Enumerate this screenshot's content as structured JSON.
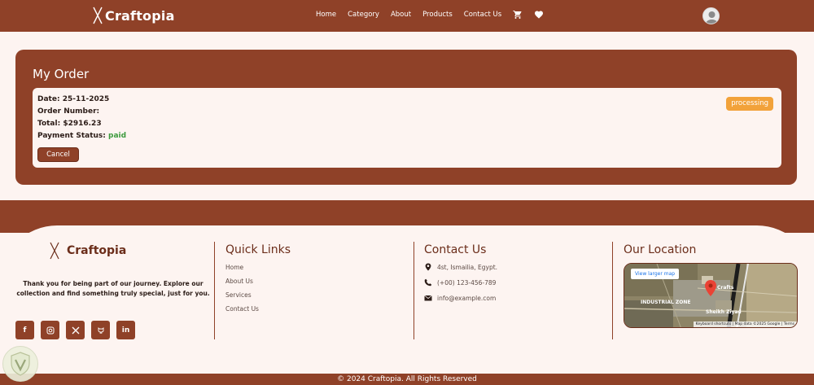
{
  "header": {
    "brand": "Craftopia",
    "nav": [
      "Home",
      "Category",
      "About",
      "Products",
      "Contact Us"
    ],
    "icons": [
      "cart-icon",
      "heart-icon",
      "user-avatar-icon"
    ]
  },
  "order": {
    "title": "My Order",
    "date_label": "Date:",
    "date": "25-11-2025",
    "number_label": "Order Number:",
    "number": "",
    "total_label": "Total:",
    "total": "$2916.23",
    "payment_label": "Payment Status:",
    "payment_status": "paid",
    "status": "processing",
    "cancel_label": "Cancel"
  },
  "footer": {
    "brand": "Craftopia",
    "tagline": "Thank you for being part of our journey. Explore our collection and find something truly special, just for you.",
    "socials": [
      "facebook-icon",
      "instagram-icon",
      "x-icon",
      "github-icon",
      "linkedin-icon"
    ],
    "quick_links_title": "Quick Links",
    "quick_links": [
      "Home",
      "About Us",
      "Services",
      "Contact Us"
    ],
    "contact_title": "Contact Us",
    "address": "4st, Ismailia, Egypt.",
    "phone": "(+00) 123-456-789",
    "email": "info@example.com",
    "location_title": "Our Location",
    "map": {
      "button": "View larger map",
      "place_label": "Crafts",
      "attribution": "Keyboard shortcuts | Map data ©2025 Google | Terms",
      "area_labels": [
        "INDUSTRIAL ZONE",
        "Sheikh Ziyad"
      ]
    },
    "copyright": "© 2024 Craftopia. All Rights Reserved"
  },
  "colors": {
    "brand": "#8f4128",
    "background": "#fdf4f1",
    "status_badge": "#f2a23a",
    "paid": "#3b9a3d"
  }
}
